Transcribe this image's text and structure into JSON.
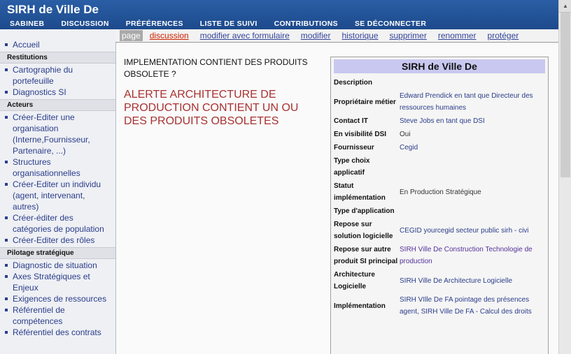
{
  "site_title": "SIRH de Ville De",
  "user_nav": [
    "SABINEB",
    "DISCUSSION",
    "PRÉFÉRENCES",
    "LISTE DE SUIVI",
    "CONTRIBUTIONS",
    "SE DÉCONNECTER"
  ],
  "tabs": [
    {
      "label": "page",
      "state": "active"
    },
    {
      "label": "discussion",
      "state": "new"
    },
    {
      "label": "modifier avec formulaire",
      "state": "normal"
    },
    {
      "label": "modifier",
      "state": "normal"
    },
    {
      "label": "historique",
      "state": "normal"
    },
    {
      "label": "supprimer",
      "state": "normal"
    },
    {
      "label": "renommer",
      "state": "normal"
    },
    {
      "label": "protéger",
      "state": "normal"
    }
  ],
  "sidebar": {
    "home": "Accueil",
    "sections": [
      {
        "title": "Restitutions",
        "items": [
          "Cartographie du portefeuille",
          "Diagnostics SI"
        ]
      },
      {
        "title": "Acteurs",
        "items": [
          "Créer-Editer une organisation (Interne,Fournisseur, Partenaire, ...)",
          "Structures organisationnelles",
          "Créer-Editer un individu (agent, intervenant, autres)",
          "Créer-éditer des catégories de population",
          "Créer-Editer des rôles"
        ]
      },
      {
        "title": "Pilotage stratégique",
        "items": [
          "Diagnostic de situation",
          "Axes Stratégiques et Enjeux",
          "Exigences de ressources",
          "Référentiel de compétences",
          "Référentiel des contrats"
        ]
      }
    ]
  },
  "main": {
    "question": "IMPLEMENTATION CONTIENT DES PRODUITS OBSOLETE ?",
    "alert": "ALERTE ARCHITECTURE DE PRODUCTION CONTIENT UN OU DES PRODUITS OBSOLETES"
  },
  "infobox": {
    "title": "SIRH de Ville De",
    "rows": [
      {
        "key": "Description",
        "value": "",
        "style": "text"
      },
      {
        "key": "Propriétaire métier",
        "value": "Edward Prendick en tant que Directeur des ressources humaines",
        "style": "link"
      },
      {
        "key": "Contact IT",
        "value": "Steve Jobs en tant que DSI",
        "style": "link"
      },
      {
        "key": "En visibilité DSI",
        "value": "Oui",
        "style": "text"
      },
      {
        "key": "Fournisseur",
        "value": "Cegid",
        "style": "link"
      },
      {
        "key": "Type choix applicatif",
        "value": "",
        "style": "text"
      },
      {
        "key": "Statut implémentation",
        "value": "En Production Stratégique",
        "style": "text"
      },
      {
        "key": "Type d'application",
        "value": "",
        "style": "text"
      },
      {
        "key": "Repose sur solution logicielle",
        "value": "CEGID yourcegid secteur public sirh - civi",
        "style": "link"
      },
      {
        "key": "Repose sur autre produit SI principal",
        "value": "SIRH Ville De Construction Technologie de production",
        "style": "visited"
      },
      {
        "key": "Architecture Logicielle",
        "value": "SIRH Ville De Architecture Logicielle",
        "style": "link"
      },
      {
        "key": "Implémentation",
        "value": "SIRH VIlle De FA pointage des présences agent, SIRH Ville De FA - Calcul des droits",
        "style": "link"
      }
    ]
  },
  "scrollbar": {
    "up_arrow": "▲"
  },
  "colors": {
    "header": "#1d4a8c",
    "link": "#2b3d8a",
    "alert": "#a83232",
    "infobox_title": "#c8c8f0"
  }
}
